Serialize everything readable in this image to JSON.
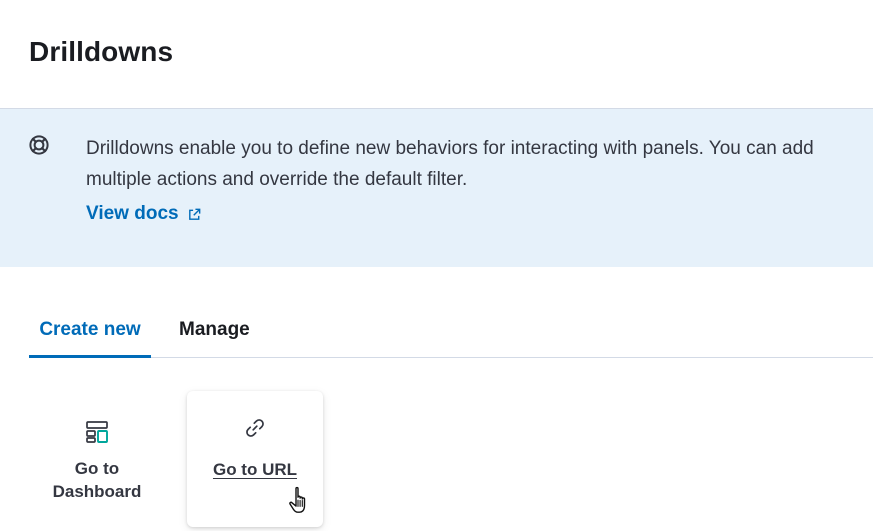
{
  "header": {
    "title": "Drilldowns"
  },
  "callout": {
    "icon": "lifebuoy-icon",
    "text": "Drilldowns enable you to define new behaviors for interacting with panels. You can add multiple actions and override the default filter.",
    "link_label": "View docs",
    "link_icon": "external-link-icon"
  },
  "tabs": [
    {
      "label": "Create new",
      "selected": true
    },
    {
      "label": "Manage",
      "selected": false
    }
  ],
  "actions": [
    {
      "label": "Go to\nDashboard",
      "icon": "dashboard-icon"
    },
    {
      "label": "Go to URL",
      "icon": "link-icon",
      "hovered": true
    }
  ],
  "colors": {
    "accent": "#006bb8",
    "callout_background": "#e6f1fa",
    "dashboard_icon_accent": "#00a69b"
  },
  "pointer": "hand-cursor-icon"
}
